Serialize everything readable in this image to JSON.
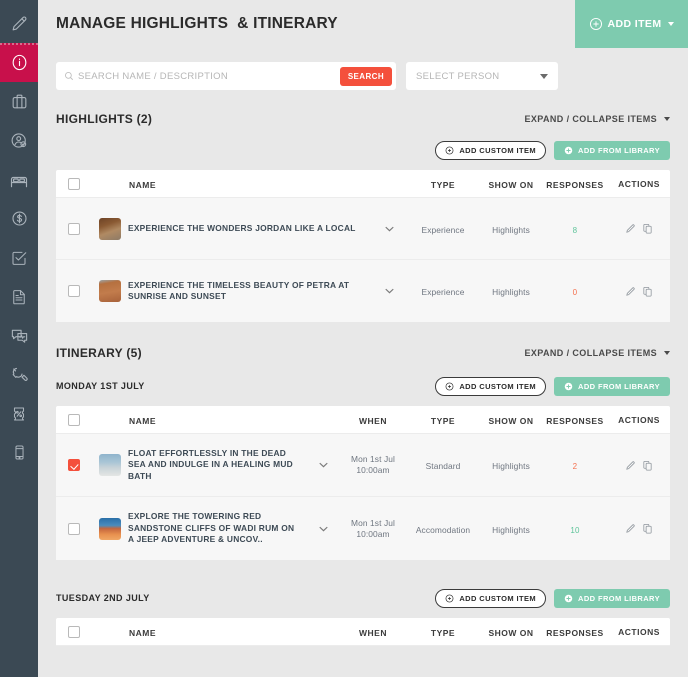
{
  "sidebar": {
    "items": [
      {
        "name": "pencil-icon",
        "label": "Edit",
        "active": false
      },
      {
        "name": "info-icon",
        "label": "Information",
        "active": true
      },
      {
        "name": "suitcase-icon",
        "label": "Trips",
        "active": false
      },
      {
        "name": "person-check-icon",
        "label": "Travellers",
        "active": false
      },
      {
        "name": "bed-icon",
        "label": "Accommodation",
        "active": false
      },
      {
        "name": "dollar-icon",
        "label": "Payments",
        "active": false
      },
      {
        "name": "checklist-icon",
        "label": "Tasks",
        "active": false
      },
      {
        "name": "document-icon",
        "label": "Documents",
        "active": false
      },
      {
        "name": "chat-pulse-icon",
        "label": "Messages",
        "active": false
      },
      {
        "name": "wrench-icon",
        "label": "Settings",
        "active": false
      },
      {
        "name": "ticket-percent-icon",
        "label": "Offers",
        "active": false
      },
      {
        "name": "mobile-icon",
        "label": "Mobile App",
        "active": false
      }
    ]
  },
  "header": {
    "title": "MANAGE HIGHLIGHTS  & ITINERARY",
    "add_item_label": "ADD ITEM"
  },
  "search": {
    "placeholder": "SEARCH NAME / DESCRIPTION",
    "value": "",
    "button_label": "SEARCH",
    "person_select_value": "SELECT PERSON"
  },
  "buttons": {
    "add_custom_item": "ADD CUSTOM ITEM",
    "add_from_library": "ADD FROM LIBRARY",
    "expand_collapse": "EXPAND / COLLAPSE ITEMS"
  },
  "colors": {
    "sidebar_bg": "#3b4954",
    "active_nav": "#c8104b",
    "accent_green": "#7ecbaf",
    "accent_red": "#f4503c",
    "resp_green": "#5fc49a",
    "resp_red": "#f4714f"
  },
  "highlights": {
    "title": "HIGHLIGHTS (2)",
    "columns": [
      "NAME",
      "TYPE",
      "SHOW ON",
      "RESPONSES",
      "ACTIONS"
    ],
    "rows": [
      {
        "checked": false,
        "thumb": "market-stall-photo",
        "name": "EXPERIENCE THE  WONDERS JORDAN LIKE A LOCAL",
        "type": "Experience",
        "show_on": "Highlights",
        "responses": "8",
        "responses_state": "green"
      },
      {
        "checked": false,
        "thumb": "petra-facade-photo",
        "name": "EXPERIENCE THE TIMELESS BEAUTY OF PETRA AT SUNRISE AND SUNSET",
        "type": "Experience",
        "show_on": "Highlights",
        "responses": "0",
        "responses_state": "red"
      }
    ]
  },
  "itinerary": {
    "title": "ITINERARY (5)",
    "columns": [
      "NAME",
      "WHEN",
      "TYPE",
      "SHOW ON",
      "RESPONSES",
      "ACTIONS"
    ],
    "days": [
      {
        "label": "MONDAY 1ST JULY",
        "rows": [
          {
            "checked": true,
            "thumb": "dead-sea-photo",
            "name": "FLOAT EFFORTLESSLY IN THE DEAD SEA AND INDULGE IN A HEALING MUD BATH",
            "when_date": "Mon 1st Jul",
            "when_time": "10:00am",
            "type": "Standard",
            "show_on": "Highlights",
            "responses": "2",
            "responses_state": "red"
          },
          {
            "checked": false,
            "thumb": "wadi-rum-photo",
            "name": "EXPLORE THE TOWERING RED SANDSTONE CLIFFS OF WADI RUM ON A JEEP ADVENTURE & UNCOV..",
            "when_date": "Mon 1st Jul",
            "when_time": "10:00am",
            "type": "Accomodation",
            "show_on": "Highlights",
            "responses": "10",
            "responses_state": "green"
          }
        ]
      },
      {
        "label": "TUESDAY 2ND JULY",
        "rows": []
      }
    ]
  }
}
